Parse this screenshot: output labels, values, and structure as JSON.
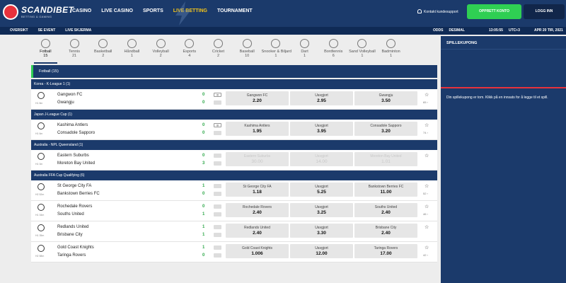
{
  "header": {
    "logo_text": "SCANDIBET",
    "logo_tagline": "BETTING & GAMING",
    "nav": [
      "CASINO",
      "LIVE CASINO",
      "SPORTS",
      "LIVE BETTING",
      "TOURNAMENT"
    ],
    "active_nav": "LIVE BETTING",
    "support": "Kontakt kundesupport",
    "open_account": "OPPRETT KONTO",
    "login": "LOGG INN"
  },
  "subnav": {
    "items": [
      "OVERSIKT",
      "SE EVENT",
      "LIVE SKJERMA"
    ],
    "odds_label": "ODDS",
    "odds_format": "DESIMAL",
    "clock": "13:05:55",
    "timezone": "UTC+3",
    "date": "APR 20 TIR, 2021"
  },
  "sports": [
    {
      "label": "Fotball",
      "count": "15",
      "icon": "football-icon",
      "active": true
    },
    {
      "label": "Tennis",
      "count": "21",
      "icon": "tennis-icon"
    },
    {
      "label": "Basketball",
      "count": "2",
      "icon": "basketball-icon"
    },
    {
      "label": "Håndball",
      "count": "1",
      "icon": "handball-icon"
    },
    {
      "label": "Volleyball",
      "count": "2",
      "icon": "volleyball-icon"
    },
    {
      "label": "Esports",
      "count": "4",
      "icon": "gamepad-icon"
    },
    {
      "label": "Cricket",
      "count": "2",
      "icon": "cricket-icon"
    },
    {
      "label": "Baseball",
      "count": "10",
      "icon": "baseball-icon"
    },
    {
      "label": "Snooker & Biljard",
      "count": "1",
      "icon": "snooker-icon"
    },
    {
      "label": "Dart",
      "count": "1",
      "icon": "dart-icon"
    },
    {
      "label": "Bordtennis",
      "count": "6",
      "icon": "table-tennis-icon"
    },
    {
      "label": "Sand Volleyball",
      "count": "1",
      "icon": "beach-volleyball-icon"
    },
    {
      "label": "Badminton",
      "count": "1",
      "icon": "badminton-icon"
    }
  ],
  "section": {
    "title": "Fotball",
    "count": "(15)"
  },
  "leagues": [
    {
      "name": "Korea - K-League 1 (1)",
      "matches": [
        {
          "time": "H1 8m",
          "home": "Gangwon FC",
          "away": "Gwangju",
          "score_home": "0",
          "score_away": "0",
          "stats": true,
          "odds": [
            {
              "name": "Gangwon FC",
              "value": "2.20"
            },
            {
              "name": "Uavgjort",
              "value": "2.95"
            },
            {
              "name": "Gwangju",
              "value": "3.50"
            }
          ],
          "more": "65 ›"
        }
      ]
    },
    {
      "name": "Japan J-League Cup (1)",
      "matches": [
        {
          "time": "H1 6m",
          "home": "Kashima Antlers",
          "away": "Consadole Sapporo",
          "score_home": "0",
          "score_away": "0",
          "stats": true,
          "odds": [
            {
              "name": "Kashima Antlers",
              "value": "1.95"
            },
            {
              "name": "Uavgjort",
              "value": "3.95"
            },
            {
              "name": "Consadole Sapporo",
              "value": "3.20"
            }
          ],
          "more": "74 ›"
        }
      ]
    },
    {
      "name": "Australia - NPL Queensland (1)",
      "matches": [
        {
          "time": "H1 0m",
          "home": "Eastern Suburbs",
          "away": "Moreton Bay United",
          "score_home": "0",
          "score_away": "3",
          "disabled": true,
          "odds": [
            {
              "name": "Eastern Suburbs",
              "value": "30.00"
            },
            {
              "name": "Uavgjort",
              "value": "14.00"
            },
            {
              "name": "Moreton Bay United",
              "value": "1.01"
            }
          ],
          "more": ""
        }
      ]
    },
    {
      "name": "Australia FFA Cup Qualifying (6)",
      "matches": [
        {
          "time": "H2 52m",
          "home": "St George City FA",
          "away": "Bankstown Berries FC",
          "score_home": "1",
          "score_away": "0",
          "odds": [
            {
              "name": "St George City FA",
              "value": "1.18"
            },
            {
              "name": "Uavgjort",
              "value": "5.25"
            },
            {
              "name": "Bankstown Berries FC",
              "value": "11.00"
            }
          ],
          "more": "52 ›"
        },
        {
          "time": "H1 34m",
          "home": "Rochedale Rovers",
          "away": "Souths United",
          "score_home": "0",
          "score_away": "1",
          "odds": [
            {
              "name": "Rochedale Rovers",
              "value": "2.40"
            },
            {
              "name": "Uavgjort",
              "value": "3.25"
            },
            {
              "name": "Souths United",
              "value": "2.40"
            }
          ],
          "more": "46 ›"
        },
        {
          "time": "H1 35m",
          "home": "Redlands United",
          "away": "Brisbane City",
          "score_home": "1",
          "score_away": "1",
          "odds": [
            {
              "name": "Redlands United",
              "value": "2.40"
            },
            {
              "name": "Uavgjort",
              "value": "3.30"
            },
            {
              "name": "Brisbane City",
              "value": "2.40"
            }
          ],
          "more": ""
        },
        {
          "time": "H2 58m",
          "home": "Gold Coast Knights",
          "away": "Taringa Rovers",
          "score_home": "1",
          "score_away": "0",
          "odds": [
            {
              "name": "Gold Coast Knights",
              "value": "1.006"
            },
            {
              "name": "Uavgjort",
              "value": "12.00"
            },
            {
              "name": "Taringa Rovers",
              "value": "17.00"
            }
          ],
          "more": "42 ›"
        }
      ]
    }
  ],
  "betslip": {
    "title": "SPILLEKUPONG",
    "message": "Din spillekupong er tom. Klikk på en innsats for å legge til et spill."
  }
}
